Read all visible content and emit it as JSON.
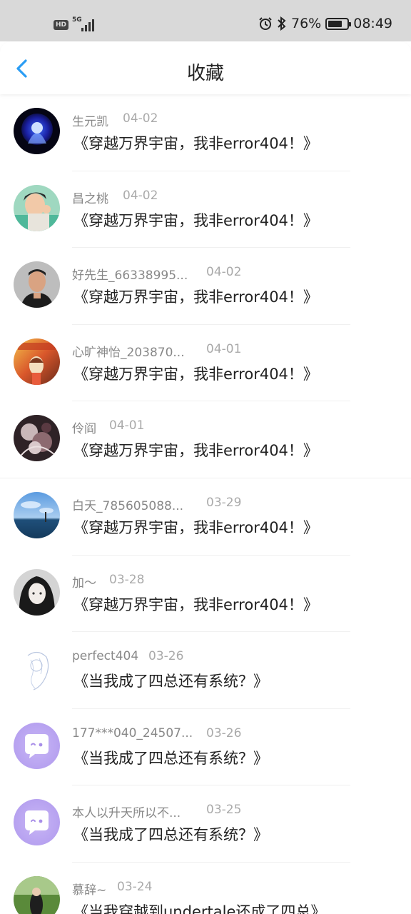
{
  "status_bar": {
    "hd": "HD",
    "network": "5G",
    "battery_percent": "76%",
    "battery_level": 0.76,
    "time": "08:49"
  },
  "header": {
    "title": "收藏"
  },
  "items": [
    {
      "name": "生元凯",
      "date": "04-02",
      "title": "《穿越万界宇宙，我非error404！》",
      "avatar": "avatar-blue-figure"
    },
    {
      "name": "昌之桃",
      "date": "04-02",
      "title": "《穿越万界宇宙，我非error404！》",
      "avatar": "avatar-child"
    },
    {
      "name": "好先生_66338995...",
      "date": "04-02",
      "title": "《穿越万界宇宙，我非error404！》",
      "avatar": "avatar-man"
    },
    {
      "name": "心旷神怡_203870...",
      "date": "04-01",
      "title": "《穿越万界宇宙，我非error404！》",
      "avatar": "avatar-colorful"
    },
    {
      "name": "伶阎",
      "date": "04-01",
      "title": "《穿越万界宇宙，我非error404！》",
      "avatar": "avatar-dark-floral"
    },
    {
      "name": "白天_785605088...",
      "date": "03-29",
      "title": "《穿越万界宇宙，我非error404！》",
      "avatar": "avatar-sea-sky"
    },
    {
      "name": "加～",
      "date": "03-28",
      "title": "《穿越万界宇宙，我非error404！》",
      "avatar": "avatar-anime-dark"
    },
    {
      "name": "perfect404",
      "date": "03-26",
      "title": "《当我成了四总还有系统？》",
      "avatar": "avatar-sketch"
    },
    {
      "name": "177***040_24507...",
      "date": "03-26",
      "title": "《当我成了四总还有系统？》",
      "avatar": "avatar-default-chat"
    },
    {
      "name": "本人以升天所以不...",
      "date": "03-25",
      "title": "《当我成了四总还有系统？》",
      "avatar": "avatar-default-chat"
    },
    {
      "name": "慕辞~",
      "date": "03-24",
      "title": "《当我穿越到undertale还成了四总》",
      "avatar": "avatar-outdoor"
    }
  ]
}
